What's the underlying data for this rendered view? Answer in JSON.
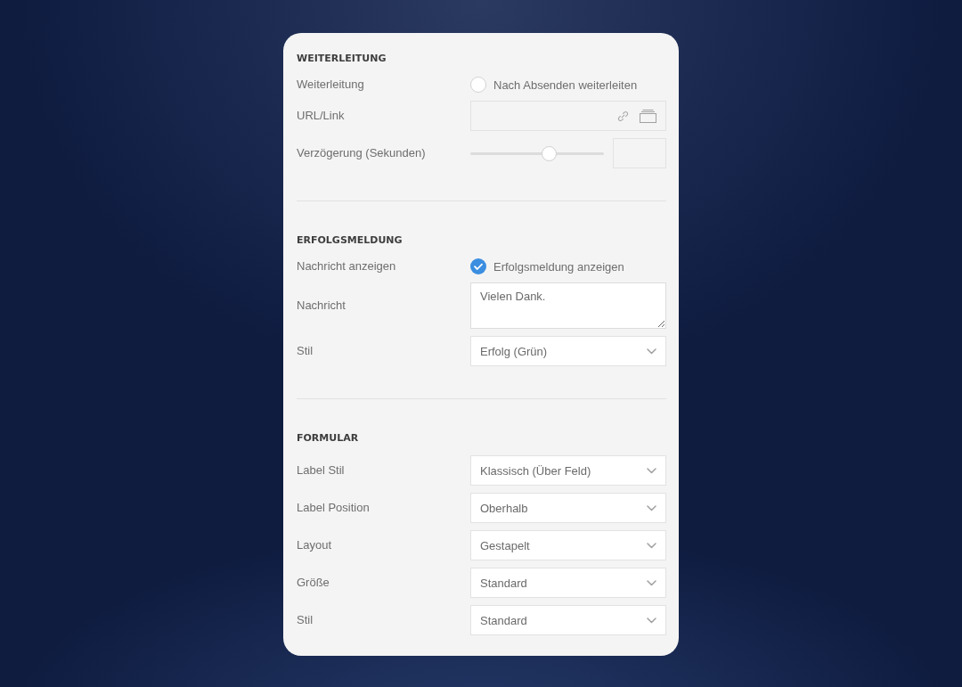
{
  "sections": [
    {
      "title": "WEITERLEITUNG",
      "rows": [
        {
          "kind": "radio",
          "label": "Weiterleitung",
          "option": "Nach Absenden weiterleiten",
          "checked": false
        },
        {
          "kind": "link_input",
          "label": "URL/Link"
        },
        {
          "kind": "slider",
          "label": "Verzögerung (Sekunden)",
          "level": 0.59
        }
      ]
    },
    {
      "title": "ERFOLGSMELDUNG",
      "rows": [
        {
          "kind": "checkbox",
          "label": "Nachricht anzeigen",
          "option": "Erfolgsmeldung anzeigen",
          "checked": true
        },
        {
          "kind": "textarea",
          "label": "Nachricht",
          "value": "Vielen Dank."
        },
        {
          "kind": "select",
          "label": "Stil",
          "value": "Erfolg (Grün)"
        }
      ]
    },
    {
      "title": "FORMULAR",
      "rows": [
        {
          "kind": "select",
          "label": "Label Stil",
          "value": "Klassisch (Über Feld)"
        },
        {
          "kind": "select",
          "label": "Label Position",
          "value": "Oberhalb"
        },
        {
          "kind": "select",
          "label": "Layout",
          "value": "Gestapelt"
        },
        {
          "kind": "select",
          "label": "Größe",
          "value": "Standard"
        },
        {
          "kind": "select",
          "label": "Stil",
          "value": "Standard"
        }
      ]
    }
  ]
}
